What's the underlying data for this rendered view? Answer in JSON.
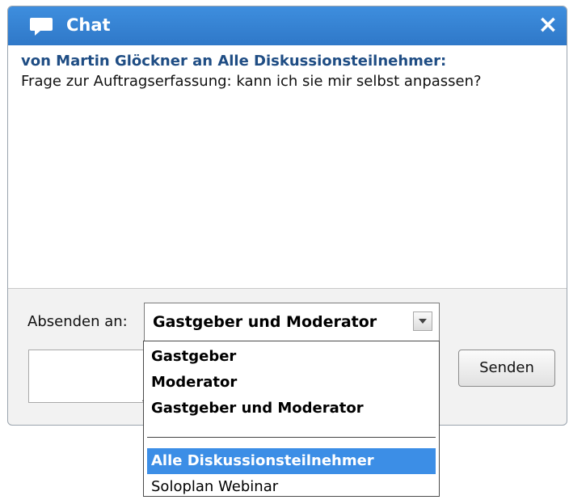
{
  "window": {
    "title": "Chat",
    "icons": {
      "title_icon": "speech-bubble-icon",
      "close": "close-icon"
    },
    "close_label": "×"
  },
  "messages": [
    {
      "sender": "von Martin Glöckner an Alle Diskussionsteilnehmer:",
      "text": "Frage zur Auftragserfassung: kann ich sie mir selbst anpassen?"
    }
  ],
  "compose": {
    "to_label": "Absenden an:",
    "selected_recipient": "Gastgeber und Moderator",
    "message_value": "",
    "send_label": "Senden"
  },
  "dropdown": {
    "options": [
      "Gastgeber",
      "Moderator",
      "Gastgeber und Moderator",
      "Alle Diskussionsteilnehmer",
      "Soloplan Webinar"
    ],
    "highlighted_option": "Alle Diskussionsteilnehmer"
  },
  "colors": {
    "titlebar": "#2f78c8",
    "sender_text": "#1f4d84",
    "highlight": "#3c8ee6"
  }
}
